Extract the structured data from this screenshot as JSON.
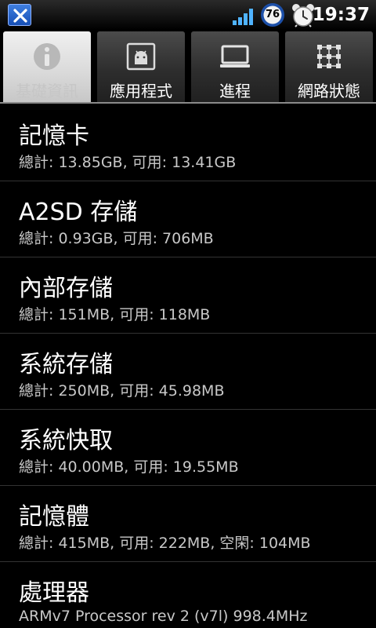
{
  "status_bar": {
    "app_icon": "x-icon",
    "signal_icon": "signal-bars-icon",
    "battery_level": "76",
    "alarm_icon": "alarm-clock-icon",
    "time": "19:37"
  },
  "tabs": [
    {
      "label": "基礎資訊",
      "icon": "info-icon",
      "selected": true
    },
    {
      "label": "應用程式",
      "icon": "android-app-icon",
      "selected": false
    },
    {
      "label": "進程",
      "icon": "monitor-icon",
      "selected": false
    },
    {
      "label": "網路狀態",
      "icon": "network-grid-icon",
      "selected": false
    }
  ],
  "items": [
    {
      "title": "記憶卡",
      "detail": "總計: 13.85GB, 可用: 13.41GB"
    },
    {
      "title": "A2SD 存儲",
      "detail": "總計: 0.93GB, 可用: 706MB"
    },
    {
      "title": "內部存儲",
      "detail": "總計: 151MB, 可用: 118MB"
    },
    {
      "title": "系統存儲",
      "detail": "總計: 250MB, 可用: 45.98MB"
    },
    {
      "title": "系統快取",
      "detail": "總計: 40.00MB, 可用: 19.55MB"
    },
    {
      "title": "記憶體",
      "detail": "總計: 415MB, 可用: 222MB, 空閑: 104MB"
    },
    {
      "title": "處理器",
      "detail": "ARMv7 Processor rev 2 (v7l)  998.4MHz"
    }
  ]
}
